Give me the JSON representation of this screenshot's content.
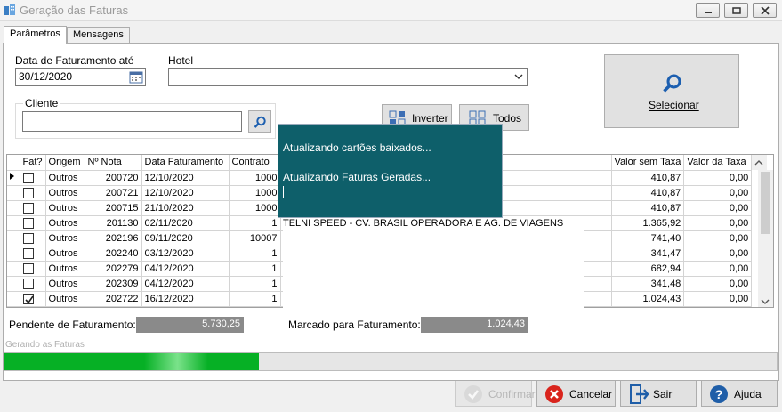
{
  "window": {
    "title": "Geração das Faturas"
  },
  "tabs": [
    {
      "label": "Parâmetros"
    },
    {
      "label": "Mensagens"
    }
  ],
  "params": {
    "data_label": "Data de Faturamento até",
    "data_value": "30/12/2020",
    "hotel_label": "Hotel",
    "hotel_value": "",
    "cliente_label": "Cliente",
    "cliente_value": "",
    "inverter_label": "Inverter",
    "todos_label": "Todos",
    "selecionar_label": "Selecionar"
  },
  "grid": {
    "headers": [
      "Fat?",
      "Origem",
      "Nº Nota",
      "Data Faturamento",
      "Contrato",
      "Valor sem Taxa",
      "Valor da Taxa"
    ],
    "partial_text": "TELNI SPEED - CV. BRASIL OPERADORA E AG. DE VIAGENS S.A.",
    "rows": [
      {
        "checked": false,
        "origem": "Outros",
        "nota": "200720",
        "data": "12/10/2020",
        "contrato": "1000",
        "valor_sem_taxa": "410,87",
        "valor_taxa": "0,00"
      },
      {
        "checked": false,
        "origem": "Outros",
        "nota": "200721",
        "data": "12/10/2020",
        "contrato": "1000",
        "valor_sem_taxa": "410,87",
        "valor_taxa": "0,00"
      },
      {
        "checked": false,
        "origem": "Outros",
        "nota": "200715",
        "data": "21/10/2020",
        "contrato": "1000",
        "valor_sem_taxa": "410,87",
        "valor_taxa": "0,00"
      },
      {
        "checked": false,
        "origem": "Outros",
        "nota": "201130",
        "data": "02/11/2020",
        "contrato": "1",
        "valor_sem_taxa": "1.365,92",
        "valor_taxa": "0,00"
      },
      {
        "checked": false,
        "origem": "Outros",
        "nota": "202196",
        "data": "09/11/2020",
        "contrato": "10007",
        "valor_sem_taxa": "741,40",
        "valor_taxa": "0,00"
      },
      {
        "checked": false,
        "origem": "Outros",
        "nota": "202240",
        "data": "03/12/2020",
        "contrato": "1",
        "valor_sem_taxa": "341,47",
        "valor_taxa": "0,00"
      },
      {
        "checked": false,
        "origem": "Outros",
        "nota": "202279",
        "data": "04/12/2020",
        "contrato": "1",
        "valor_sem_taxa": "682,94",
        "valor_taxa": "0,00"
      },
      {
        "checked": false,
        "origem": "Outros",
        "nota": "202309",
        "data": "04/12/2020",
        "contrato": "1",
        "valor_sem_taxa": "341,48",
        "valor_taxa": "0,00"
      },
      {
        "checked": true,
        "origem": "Outros",
        "nota": "202722",
        "data": "16/12/2020",
        "contrato": "1",
        "valor_sem_taxa": "1.024,43",
        "valor_taxa": "0,00"
      }
    ]
  },
  "popup": {
    "line1": "Atualizando cartões baixados...",
    "line2": "Atualizando Faturas Geradas..."
  },
  "summary": {
    "pendente_label": "Pendente de Faturamento:",
    "pendente_value": "5.730,25",
    "marcado_label": "Marcado para Faturamento:",
    "marcado_value": "1.024,43"
  },
  "status": {
    "text": "Gerando as Faturas",
    "progress": 0.33
  },
  "buttons": {
    "confirmar": "Confirmar",
    "cancelar": "Cancelar",
    "sair": "Sair",
    "ajuda": "Ajuda"
  },
  "colors": {
    "popup_bg": "#0e5f6a",
    "progress": "#06b025",
    "readonly_bg": "#8a8a8a"
  }
}
